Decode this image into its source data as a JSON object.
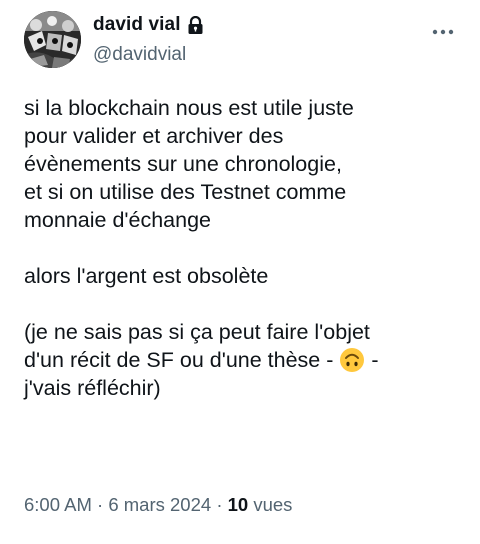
{
  "author": {
    "display_name": "david vial",
    "handle": "@davidvial",
    "protected_icon": "lock-icon",
    "avatar_icon": "avatar-illustration"
  },
  "menu_icon": "more-horizontal-icon",
  "tweet": {
    "paragraphs": [
      [
        "si la blockchain nous est utile juste",
        "pour valider et archiver des",
        "évènements sur une chronologie,",
        "et si on utilise des Testnet comme",
        "monnaie d'échange"
      ],
      [
        "alors l'argent est obsolète"
      ]
    ],
    "last_paragraph": {
      "line1": "(je ne sais pas si ça peut faire l'objet",
      "line2_before": "d'un récit de SF ou d'une thèse - ",
      "line2_after": " -",
      "line3": "j'vais réfléchir)",
      "emoji_icon": "upside-down-face-emoji"
    }
  },
  "meta": {
    "time": "6:00 AM",
    "separator": "·",
    "date": "6 mars 2024",
    "views_count": "10",
    "views_label": "vues"
  },
  "colors": {
    "text": "#0f1419",
    "secondary": "#536471",
    "emoji": "#FFC83D"
  }
}
